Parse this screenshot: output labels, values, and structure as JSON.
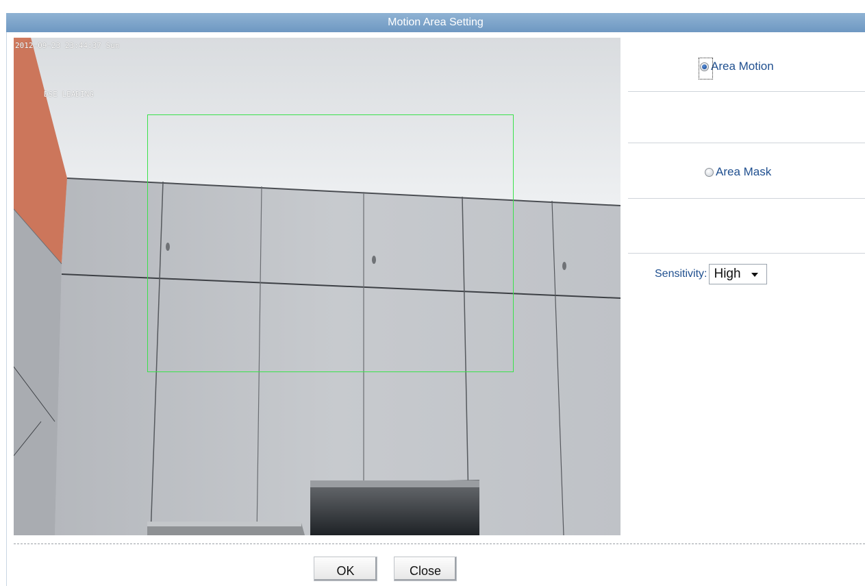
{
  "dialog": {
    "title": "Motion Area Setting"
  },
  "video": {
    "osd_timestamp": "2012-09-23 23:44:37 Sun",
    "osd_camera_name": "DSE LEADING",
    "motion_area_color": "#39e24a"
  },
  "panel": {
    "options": [
      {
        "label": "Area Motion",
        "selected": true
      },
      {
        "label": "Area Mask",
        "selected": false
      }
    ],
    "sensitivity": {
      "label": "Sensitivity:",
      "value": "High"
    }
  },
  "buttons": {
    "ok_label": "OK",
    "close_label": "Close"
  },
  "colors": {
    "title_bar": "#7aa3cb",
    "label_text": "#1f4f8f"
  }
}
